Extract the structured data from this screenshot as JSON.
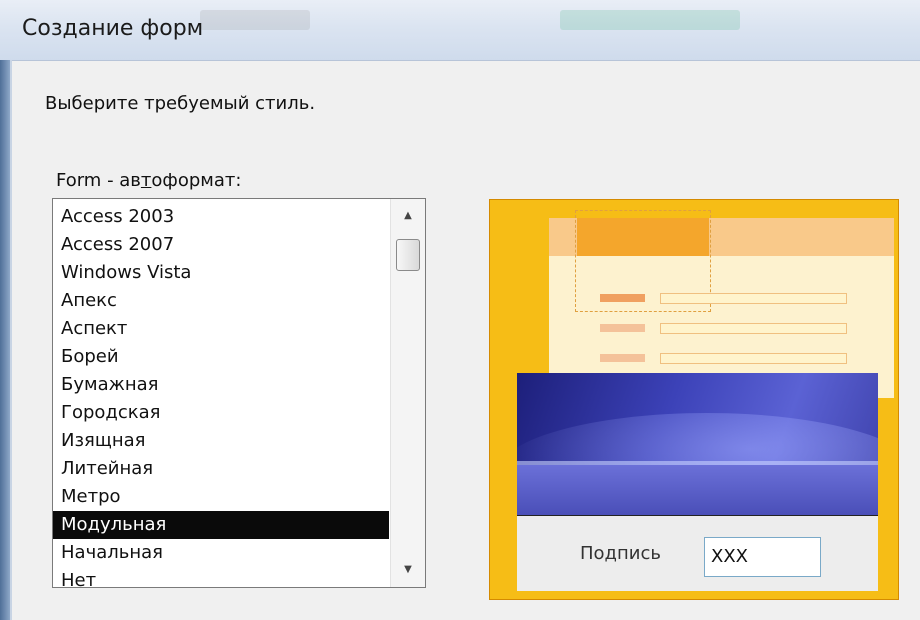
{
  "window": {
    "title": "Создание форм"
  },
  "instruction": "Выберите требуемый стиль.",
  "style_list": {
    "label_prefix": "Form - ав",
    "label_mnemonic": "т",
    "label_suffix": "оформат:",
    "items": [
      "Access 2003",
      "Access 2007",
      "Windows Vista",
      "Апекс",
      "Аспект",
      "Борей",
      "Бумажная",
      "Городская",
      "Изящная",
      "Литейная",
      "Метро",
      "Модульная",
      "Начальная",
      "Нет"
    ],
    "selected": "Модульная"
  },
  "preview": {
    "caption_label": "Подпись",
    "textbox_value": "XXX"
  },
  "colors": {
    "accent_yellow": "#f6bd16",
    "selection": "#0a0a0a",
    "panel_blue": "#3c42b8"
  },
  "icons": {
    "scroll_up": "triangle-up",
    "scroll_down": "triangle-down"
  }
}
